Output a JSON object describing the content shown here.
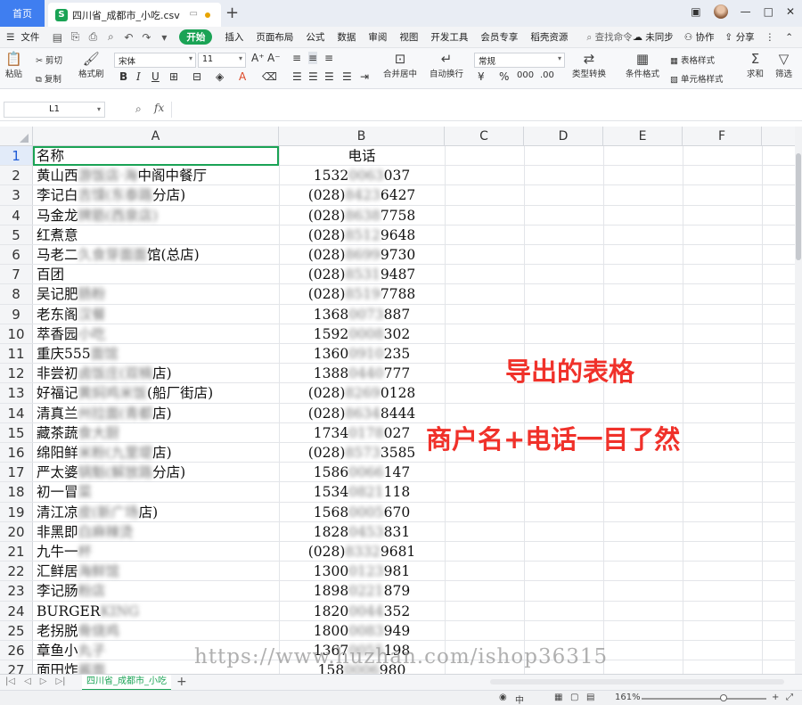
{
  "titlebar": {
    "home_tab": "首页",
    "doc_tab": "四川省_成都市_小吃.csv",
    "doc_tab_icon": "S",
    "new_tab": "+",
    "window_controls": [
      "□",
      "—",
      "□",
      "✕"
    ]
  },
  "menubar": {
    "file": "文件",
    "items": [
      "开始",
      "插入",
      "页面布局",
      "公式",
      "数据",
      "审阅",
      "视图",
      "开发工具",
      "会员专享",
      "稻壳资源"
    ],
    "active": "开始",
    "search": "查找命令...",
    "right": [
      "未同步",
      "协作",
      "分享"
    ]
  },
  "ribbon": {
    "paste": "粘贴",
    "cut": "剪切",
    "copy": "复制",
    "format_painter": "格式刷",
    "font_name": "宋体",
    "font_size": "11",
    "merge_center": "合并居中",
    "wrap_text": "自动换行",
    "number_format": "常规",
    "type_convert": "类型转换",
    "cond_format": "条件格式",
    "table_style": "表格样式",
    "cell_style": "单元格样式",
    "sum": "求和",
    "filter": "筛选",
    "currency": "¥",
    "percent": "%"
  },
  "formula_bar": {
    "name_box": "L1",
    "fx": "fx",
    "value": ""
  },
  "grid": {
    "columns": [
      "A",
      "B",
      "C",
      "D",
      "E",
      "F"
    ],
    "rows": [
      {
        "n": "1",
        "a": "名称",
        "b": "电话"
      },
      {
        "n": "2",
        "a_vis": "黄山西",
        "a_blur": "游饭店·海",
        "a_tail": "中阁中餐厅",
        "b_vis": "1532",
        "b_blur": "0063",
        "b_tail": "037"
      },
      {
        "n": "3",
        "a_vis": "李记白",
        "a_blur": "吉馍(东泰路",
        "a_tail": "分店)",
        "b_vis": "(028)",
        "b_blur": "8423",
        "b_tail": "6427"
      },
      {
        "n": "4",
        "a_vis": "马金龙",
        "a_blur": "牌筋(西泉店)",
        "a_tail": "",
        "b_vis": "(028)",
        "b_blur": "8638",
        "b_tail": "7758"
      },
      {
        "n": "5",
        "a_vis": "红煮意",
        "a_blur": "",
        "a_tail": "",
        "b_vis": "(028)",
        "b_blur": "8512",
        "b_tail": "9648"
      },
      {
        "n": "6",
        "a_vis": "马老二",
        "a_blur": "久食芽面面",
        "a_tail": "馆(总店)",
        "b_vis": "(028)",
        "b_blur": "8699",
        "b_tail": "9730"
      },
      {
        "n": "7",
        "a_vis": "百团",
        "a_blur": "",
        "a_tail": "",
        "b_vis": "(028)",
        "b_blur": "8531",
        "b_tail": "9487"
      },
      {
        "n": "8",
        "a_vis": "吴记肥",
        "a_blur": "肠粉",
        "a_tail": "",
        "b_vis": "(028)",
        "b_blur": "8519",
        "b_tail": "7788"
      },
      {
        "n": "9",
        "a_vis": "老东阁",
        "a_blur": "汉餐",
        "a_tail": "",
        "b_vis": "1368",
        "b_blur": "0073",
        "b_tail": "887"
      },
      {
        "n": "10",
        "a_vis": "萃香园",
        "a_blur": "小吃",
        "a_tail": "",
        "b_vis": "1592",
        "b_blur": "0008",
        "b_tail": "302"
      },
      {
        "n": "11",
        "a_vis": "重庆555",
        "a_blur": "面馆",
        "a_tail": "",
        "b_vis": "1360",
        "b_blur": "0910",
        "b_tail": "235"
      },
      {
        "n": "12",
        "a_vis": "非尝初",
        "a_blur": "卤饭庄(双楠",
        "a_tail": "店)",
        "b_vis": "1388",
        "b_blur": "0440",
        "b_tail": "777"
      },
      {
        "n": "13",
        "a_vis": "好福记",
        "a_blur": "黄焖鸡米饭",
        "a_tail": "(船厂街店)",
        "b_vis": "(028)",
        "b_blur": "8269",
        "b_tail": "0128"
      },
      {
        "n": "14",
        "a_vis": "清真兰",
        "a_blur": "州拉面(青都",
        "a_tail": "店)",
        "b_vis": "(028)",
        "b_blur": "8634",
        "b_tail": "8444"
      },
      {
        "n": "15",
        "a_vis": "藏茶蔬",
        "a_blur": "食大厨",
        "a_tail": "",
        "b_vis": "1734",
        "b_blur": "0178",
        "b_tail": "027"
      },
      {
        "n": "16",
        "a_vis": "绵阳鲜",
        "a_blur": "米粉(九里堤",
        "a_tail": "店)",
        "b_vis": "(028)",
        "b_blur": "8573",
        "b_tail": "3585"
      },
      {
        "n": "17",
        "a_vis": "严太婆",
        "a_blur": "锅魁(解放路",
        "a_tail": "分店)",
        "b_vis": "1586",
        "b_blur": "0066",
        "b_tail": "147"
      },
      {
        "n": "18",
        "a_vis": "初一冒",
        "a_blur": "菜",
        "a_tail": "",
        "b_vis": "1534",
        "b_blur": "0821",
        "b_tail": "118"
      },
      {
        "n": "19",
        "a_vis": "清江凉",
        "a_blur": "皮(新广场",
        "a_tail": "店)",
        "b_vis": "1568",
        "b_blur": "0005",
        "b_tail": "670"
      },
      {
        "n": "20",
        "a_vis": "非黑即",
        "a_blur": "白麻辣烫",
        "a_tail": "",
        "b_vis": "1828",
        "b_blur": "0453",
        "b_tail": "831"
      },
      {
        "n": "21",
        "a_vis": "九牛一",
        "a_blur": "杯",
        "a_tail": "",
        "b_vis": "(028)",
        "b_blur": "8332",
        "b_tail": "9681"
      },
      {
        "n": "22",
        "a_vis": "汇鲜居",
        "a_blur": "海鲜馆",
        "a_tail": "",
        "b_vis": "1300",
        "b_blur": "0123",
        "b_tail": "981"
      },
      {
        "n": "23",
        "a_vis": "李记肠",
        "a_blur": "粉店",
        "a_tail": "",
        "b_vis": "1898",
        "b_blur": "0221",
        "b_tail": "879"
      },
      {
        "n": "24",
        "a_vis": "BURGER",
        "a_blur": "KING",
        "a_tail": "",
        "b_vis": "1820",
        "b_blur": "0044",
        "b_tail": "352"
      },
      {
        "n": "25",
        "a_vis": "老拐脱",
        "a_blur": "骨烧鸡",
        "a_tail": "",
        "b_vis": "1800",
        "b_blur": "0083",
        "b_tail": "949"
      },
      {
        "n": "26",
        "a_vis": "章鱼小",
        "a_blur": "丸子",
        "a_tail": "",
        "b_vis": "1367",
        "b_blur": "0055",
        "b_tail": "198"
      },
      {
        "n": "27",
        "a_vis": "面田炸",
        "a_blur": "酱面",
        "a_tail": "",
        "b_vis": "158",
        "b_blur": "0006",
        "b_tail": "980"
      }
    ]
  },
  "annotations": {
    "line1": "导出的表格",
    "line2": "商户名+电话一目了然",
    "color": "#f0312a"
  },
  "watermark": "https://www.huzhan.com/ishop36315",
  "sheets": {
    "active": "四川省_成都市_小吃",
    "add": "+"
  },
  "statusbar": {
    "zoom": "161%",
    "input_mode": "中"
  },
  "colors": {
    "accent": "#1aa355",
    "home_tab": "#3f7ef0"
  }
}
